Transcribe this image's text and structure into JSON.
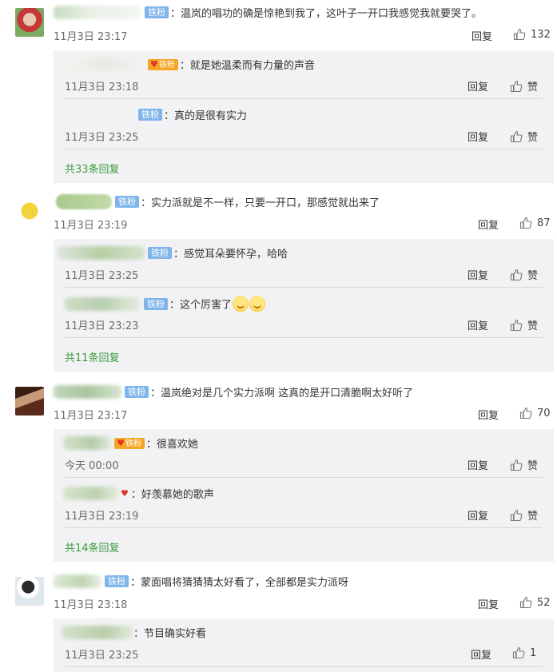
{
  "labels": {
    "reply": "回复",
    "like": "赞",
    "fan_badge": "铁粉",
    "vip_badge": "铁粉"
  },
  "comments": [
    {
      "text": "：温岚的唱功的确是惊艳到我了，这叶子一开口我感觉我就要哭了。",
      "time": "11月3日 23:17",
      "likes": "132",
      "replies": [
        {
          "text": "：就是她温柔而有力量的声音",
          "time": "11月3日 23:18"
        },
        {
          "text": "：真的是很有实力",
          "time": "11月3日 23:25"
        }
      ],
      "more": "共33条回复"
    },
    {
      "text": "：实力派就是不一样，只要一开口，那感觉就出来了",
      "time": "11月3日 23:19",
      "likes": "87",
      "replies": [
        {
          "text": "：感觉耳朵要怀孕，哈哈",
          "time": "11月3日 23:25"
        },
        {
          "text": "：这个厉害了",
          "time": "11月3日 23:23"
        }
      ],
      "more": "共11条回复"
    },
    {
      "text": "：温岚绝对是几个实力派啊 这真的是开口清脆啊太好听了",
      "time": "11月3日 23:17",
      "likes": "70",
      "replies": [
        {
          "text": "：很喜欢她",
          "time": "今天 00:00"
        },
        {
          "text": "：好羡慕她的歌声",
          "time": "11月3日 23:19"
        }
      ],
      "more": "共14条回复"
    },
    {
      "text": "：蒙面唱将猜猜猜太好看了，全部都是实力派呀",
      "time": "11月3日 23:18",
      "likes": "52",
      "replies": [
        {
          "text": "：节目确实好看",
          "time": "11月3日 23:25",
          "likes": "1"
        }
      ]
    }
  ],
  "icons": {
    "like": "thumbs-up-icon",
    "emoji": "smile-emoji-icon"
  },
  "colors": {
    "badge": "#7fb5ea",
    "vip": "#f5a623",
    "more_link": "#3a9a3a",
    "reply_bg": "#f2f2f5"
  }
}
